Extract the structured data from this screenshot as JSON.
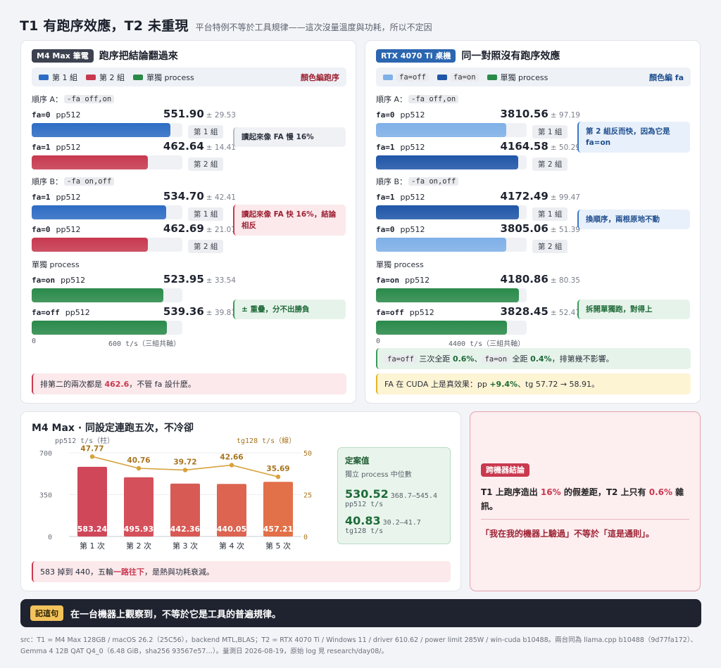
{
  "header": {
    "title": "T1 有跑序效應，T2 未重現",
    "subtitle": "平台特例不等於工具規律——這次沒量溫度與功耗，所以不定因"
  },
  "t1": {
    "tag": "M4 Max 筆電",
    "title": "跑序把結論翻過來",
    "legend": {
      "items": [
        "第 1 組",
        "第 2 組",
        "單獨 process"
      ],
      "note": "顏色編跑序"
    },
    "order_a": {
      "label": "順序 A：",
      "code": "-fa off,on",
      "rows": [
        {
          "flag": "fa=0",
          "test": "pp512",
          "value": "551.90",
          "sd": "± 29.53",
          "fill": 0.92,
          "chip": "第 1 組"
        },
        {
          "flag": "fa=1",
          "test": "pp512",
          "value": "462.64",
          "sd": "± 14.41",
          "fill": 0.771,
          "chip": "第 2 組"
        }
      ],
      "note": "讀起來像 FA 慢 16%"
    },
    "order_b": {
      "label": "順序 B：",
      "code": "-fa on,off",
      "rows": [
        {
          "flag": "fa=1",
          "test": "pp512",
          "value": "534.70",
          "sd": "± 42.41",
          "fill": 0.891,
          "chip": "第 1 組"
        },
        {
          "flag": "fa=0",
          "test": "pp512",
          "value": "462.69",
          "sd": "± 21.07",
          "fill": 0.771,
          "chip": "第 2 組"
        }
      ],
      "note": "讀起來像 FA 快 16%，結論相反"
    },
    "single": {
      "label": "單獨 process",
      "rows": [
        {
          "flag": "fa=on",
          "test": "pp512",
          "value": "523.95",
          "sd": "± 33.54",
          "fill": 0.873
        },
        {
          "flag": "fa=off",
          "test": "pp512",
          "value": "539.36",
          "sd": "± 39.81",
          "fill": 0.899
        }
      ],
      "note": "± 重疊，分不出勝負"
    },
    "axis": {
      "min": "0",
      "max": "600 t/s（三組共軸）"
    },
    "footer": {
      "pre": "排第二的兩次都是 ",
      "em": "462.6",
      "post": "，不管 fa 設什麼。"
    }
  },
  "t2": {
    "tag": "RTX 4070 Ti 桌機",
    "title": "同一對照沒有跑序效應",
    "legend": {
      "items": [
        "fa=off",
        "fa=on",
        "單獨 process"
      ],
      "note": "顏色編 fa"
    },
    "order_a": {
      "label": "順序 A：",
      "code": "-fa off,on",
      "rows": [
        {
          "flag": "fa=0",
          "test": "pp512",
          "value": "3810.56",
          "sd": "± 97.19",
          "fill": 0.866,
          "chip": "第 1 組"
        },
        {
          "flag": "fa=1",
          "test": "pp512",
          "value": "4164.58",
          "sd": "± 50.29",
          "fill": 0.946,
          "chip": "第 2 組"
        }
      ],
      "note": "第 2 組反而快，因為它是 fa=on"
    },
    "order_b": {
      "label": "順序 B：",
      "code": "-fa on,off",
      "rows": [
        {
          "flag": "fa=1",
          "test": "pp512",
          "value": "4172.49",
          "sd": "± 99.47",
          "fill": 0.948,
          "chip": "第 1 組"
        },
        {
          "flag": "fa=0",
          "test": "pp512",
          "value": "3805.06",
          "sd": "± 51.39",
          "fill": 0.865,
          "chip": "第 2 組"
        }
      ],
      "note": "換順序，兩根原地不動"
    },
    "single": {
      "label": "單獨 process",
      "rows": [
        {
          "flag": "fa=on",
          "test": "pp512",
          "value": "4180.86",
          "sd": "± 80.35",
          "fill": 0.95
        },
        {
          "flag": "fa=off",
          "test": "pp512",
          "value": "3828.45",
          "sd": "± 52.47",
          "fill": 0.87
        }
      ],
      "note": "拆開單獨跑，對得上"
    },
    "axis": {
      "min": "0",
      "max": "4400 t/s（三組共軸）"
    },
    "footer_green": {
      "c1": "fa=off",
      "t1": " 三次全距 ",
      "v1": "0.6%",
      "sep": "、",
      "c2": "fa=on",
      "t2": " 全距 ",
      "v2": "0.4%",
      "post": "，排第幾不影響。"
    },
    "footer_yellow": {
      "pre": "FA 在 CUDA 上是真效果：pp ",
      "em": "+9.4%",
      "post": "、tg 57.72 → 58.91。"
    }
  },
  "t3": {
    "title": "M4 Max · 同設定連跑五次，不冷卻",
    "defbox": {
      "title": "定案值",
      "sub": "獨立 process 中位數",
      "pp": "530.52",
      "pp_range": "368.7–545.4",
      "pp_unit": "pp512 t/s",
      "tg": "40.83",
      "tg_range": "30.2–41.7",
      "tg_unit": "tg128 t/s"
    },
    "footer": {
      "pre": "583 掉到 440，五輪",
      "em": "一路往下",
      "post": "，是熱與功耗衰減。"
    }
  },
  "chart_data": {
    "type": "bar",
    "categories": [
      "第 1 次",
      "第 2 次",
      "第 3 次",
      "第 4 次",
      "第 5 次"
    ],
    "series": [
      {
        "name": "pp512 t/s（柱）",
        "values": [
          583.24,
          495.93,
          442.36,
          440.05,
          457.21
        ],
        "axis": "left"
      },
      {
        "name": "tg128 t/s（線）",
        "values": [
          47.77,
          40.76,
          39.72,
          42.66,
          35.69
        ],
        "axis": "right",
        "type": "line"
      }
    ],
    "ylim": [
      0,
      700
    ],
    "y2lim": [
      0,
      50
    ],
    "yticks": [
      "0",
      "350",
      "700"
    ],
    "y2ticks": [
      "0",
      "25",
      "50"
    ],
    "ylabel": "pp512 t/s（柱）",
    "y2label": "tg128 t/s（線）",
    "bar_labels": [
      "583.24",
      "495.93",
      "442.36",
      "440.05",
      "457.21"
    ],
    "line_labels": [
      "47.77",
      "40.76",
      "39.72",
      "42.66",
      "35.69"
    ],
    "bar_colors": [
      "#d0475a",
      "#d4505a",
      "#d85a55",
      "#dc6450",
      "#e27048"
    ],
    "line_color": "#d6a23c"
  },
  "t4": {
    "tag": "跨機器結論",
    "l1_pre": "T1 上跑序造出 ",
    "l1_em1": "16%",
    "l1_mid": " 的假差距，T2 上只有 ",
    "l1_em2": "0.6%",
    "l1_post": " 雜訊。",
    "l2": "「我在我的機器上驗過」不等於「這是通則」。"
  },
  "banner": {
    "key": "記這句",
    "msg": "在一台機器上觀察到，不等於它是工具的普遍規律。"
  },
  "source": "src：T1 = M4 Max 128GB / macOS 26.2（25C56），backend MTL,BLAS；T2 = RTX 4070 Ti / Windows 11 / driver 610.62 / power limit 285W / win-cuda b10488。兩台同為 llama.cpp b10488（9d77fa172）、Gemma 4 12B QAT Q4_0（6.48 GiB，sha256 93567e57…）。量測日 2026-08-19，原始 log 見 research/day08/。",
  "colors": {
    "g1": "#2d6cc4",
    "g2": "#c8394f",
    "single": "#2a8a4a",
    "fa_off": "#7fb0e8",
    "fa_on": "#1f56a8"
  }
}
